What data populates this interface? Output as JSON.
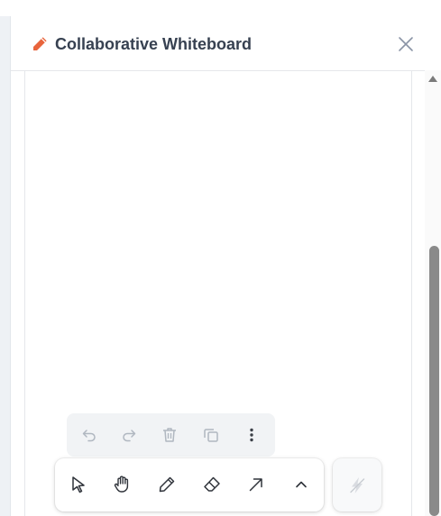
{
  "panel": {
    "title": "Collaborative Whiteboard",
    "title_icon": "pencil-icon",
    "close_icon": "close-icon",
    "accent_color": "#e8643c"
  },
  "secondary_toolbar": {
    "tools": [
      "undo-icon",
      "redo-icon",
      "trash-icon",
      "duplicate-icon",
      "more-vertical-icon"
    ]
  },
  "main_toolbar": {
    "tools": [
      "select-pointer-icon",
      "hand-pan-icon",
      "pencil-draw-icon",
      "eraser-icon",
      "arrow-icon",
      "chevron-up-icon"
    ]
  },
  "side_action": {
    "icon": "lightning-icon",
    "state": "disabled"
  }
}
